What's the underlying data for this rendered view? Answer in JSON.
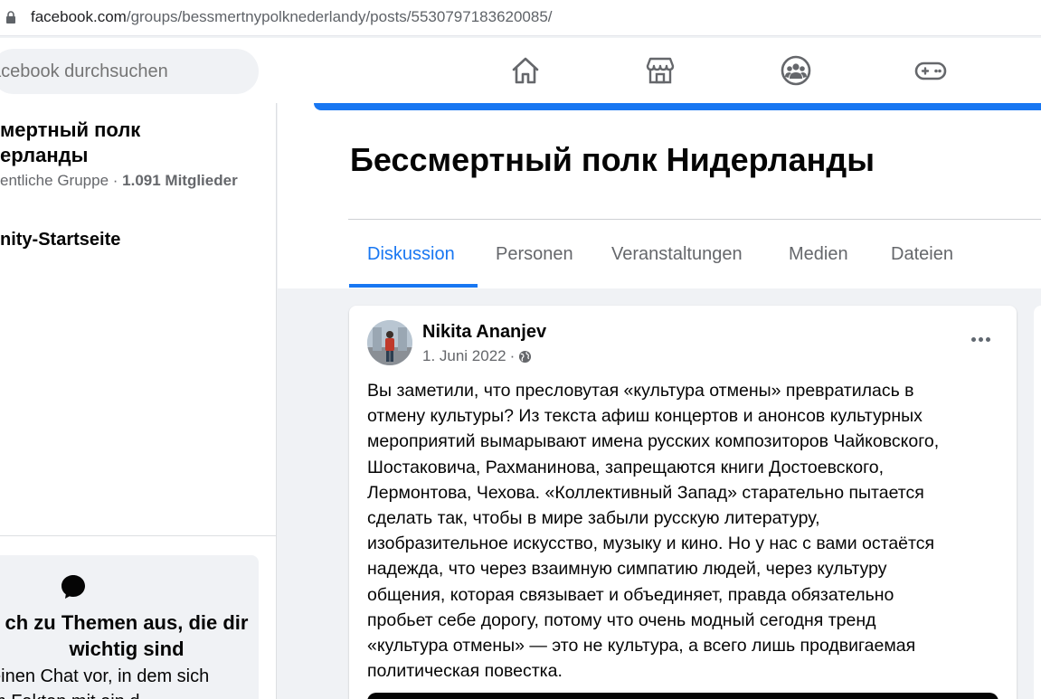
{
  "browser": {
    "url_domain": "facebook.com",
    "url_path": "/groups/bessmertnypolknederlandy/posts/5530797183620085/"
  },
  "topnav": {
    "search_placeholder": "acebook durchsuchen",
    "icons": [
      "home-icon",
      "marketplace-icon",
      "groups-icon",
      "gaming-icon"
    ]
  },
  "sidebar": {
    "group_name_line1": "мертный полк",
    "group_name_line2": "ерланды",
    "group_type": "entliche Gruppe",
    "member_count": "1.091 Mitglieder",
    "community_home": "nity-Startseite",
    "chat_card": {
      "title": "ch zu Themen aus, die dir wichtig sind",
      "text_line1": "einen Chat vor, in dem sich",
      "text_line2": "m   Fakten mit ein   d"
    }
  },
  "header": {
    "group_title": "Бессмертный полк Нидерланды",
    "tabs": [
      {
        "label": "Diskussion",
        "active": true
      },
      {
        "label": "Personen",
        "active": false
      },
      {
        "label": "Veranstaltungen",
        "active": false
      },
      {
        "label": "Medien",
        "active": false
      },
      {
        "label": "Dateien",
        "active": false
      }
    ]
  },
  "post": {
    "author": "Nikita Ananjev",
    "date": "1. Juni 2022",
    "separator": "·",
    "privacy_icon": "globe-icon",
    "lines": [
      "Вы заметили, что пресловутая «культура отмены» превратилась в",
      "отмену культуры? Из текста афиш концертов и анонсов культурных",
      "мероприятий вымарывают имена русских композиторов Чайковского,",
      "Шостаковича, Рахманинова, запрещаются книги Достоевского,",
      "Лермонтова, Чехова. «Коллективный Запад» старательно пытается",
      "сделать так, чтобы в мире забыли русскую литературу,",
      "изобразительное искусство, музыку и кино. Но у нас с вами остаётся",
      "надежда, что через взаимную симпатию людей, через культуру",
      "общения, которая связывает и объединяет, правда обязательно",
      "пробьет себе дорогу, потому что очень модный сегодня тренд",
      "«культура отмены» — это не культура, а всего лишь продвигаемая",
      "политическая повестка."
    ]
  },
  "colors": {
    "accent": "#1877f2",
    "text_primary": "#050505",
    "text_secondary": "#65676b",
    "page_bg": "#f0f2f5"
  }
}
